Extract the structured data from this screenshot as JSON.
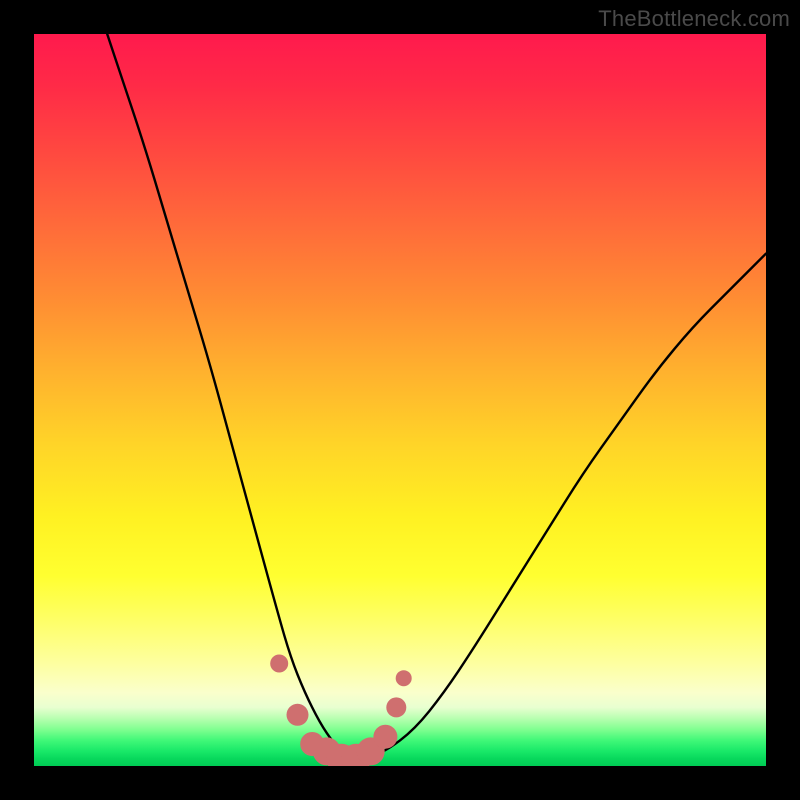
{
  "watermark": "TheBottleneck.com",
  "chart_data": {
    "type": "line",
    "title": "",
    "xlabel": "",
    "ylabel": "",
    "xlim": [
      0,
      100
    ],
    "ylim": [
      0,
      100
    ],
    "series": [
      {
        "name": "bottleneck-curve",
        "x": [
          10,
          12,
          15,
          18,
          21,
          24,
          27,
          30,
          33,
          35,
          37,
          39,
          41,
          43,
          45,
          48,
          52,
          56,
          60,
          65,
          70,
          75,
          80,
          85,
          90,
          95,
          100
        ],
        "y": [
          100,
          94,
          85,
          75,
          65,
          55,
          44,
          33,
          22,
          15,
          10,
          6,
          3,
          1,
          1,
          2,
          5,
          10,
          16,
          24,
          32,
          40,
          47,
          54,
          60,
          65,
          70
        ]
      }
    ],
    "markers": {
      "name": "highlighted-points",
      "color": "#cf6f6f",
      "x": [
        33.5,
        36,
        38,
        40,
        42,
        44,
        46,
        48,
        49.5,
        50.5
      ],
      "y": [
        14,
        7,
        3,
        2,
        1,
        1,
        2,
        4,
        8,
        12
      ],
      "size": [
        9,
        11,
        12,
        14,
        15,
        15,
        14,
        12,
        10,
        8
      ]
    },
    "background_gradient": {
      "top": "#ff1a4d",
      "middle": "#ffe524",
      "bottom": "#00cc55"
    }
  }
}
